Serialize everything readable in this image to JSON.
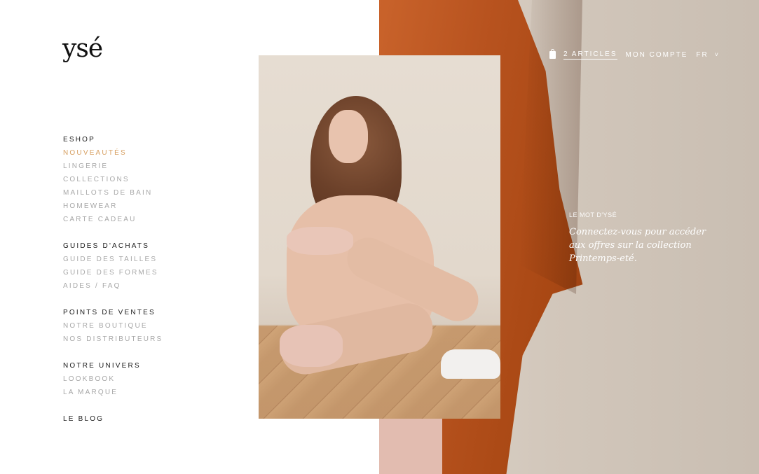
{
  "brand": {
    "logo_text": "ysé"
  },
  "nav": [
    {
      "heading": "ESHOP",
      "items": [
        {
          "label": "NOUVEAUTÉS",
          "active": true
        },
        {
          "label": "LINGERIE"
        },
        {
          "label": "COLLECTIONS"
        },
        {
          "label": "MAILLOTS DE BAIN"
        },
        {
          "label": "HOMEWEAR"
        },
        {
          "label": "CARTE CADEAU"
        }
      ]
    },
    {
      "heading": "GUIDES D'ACHATS",
      "items": [
        {
          "label": "GUIDE DES TAILLES"
        },
        {
          "label": "GUIDE DES FORMES"
        },
        {
          "label": "AIDES / FAQ"
        }
      ]
    },
    {
      "heading": "POINTS DE VENTES",
      "items": [
        {
          "label": "NOTRE BOUTIQUE"
        },
        {
          "label": "NOS DISTRIBUTEURS"
        }
      ]
    },
    {
      "heading": "NOTRE UNIVERS",
      "items": [
        {
          "label": "LOOKBOOK"
        },
        {
          "label": "LA MARQUE"
        }
      ]
    },
    {
      "heading": "LE BLOG",
      "items": []
    }
  ],
  "top_nav": {
    "cart_label": "2 ARTICLES",
    "account_label": "MON COMPTE",
    "language": "FR"
  },
  "mot": {
    "label": "LE MOT D'YSÉ",
    "text": "Connectez-vous pour accéder aux offres sur la collection Printemps-eté."
  },
  "colors": {
    "accent": "#d7a062",
    "nav_muted": "#a8a8a8",
    "nav_heading": "#1a1a1a"
  }
}
